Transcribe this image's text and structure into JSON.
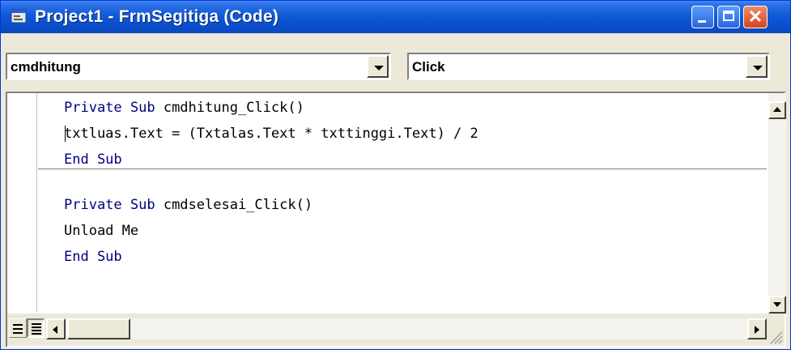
{
  "window": {
    "title": "Project1 - FrmSegitiga (Code)",
    "colors": {
      "titlebar": "#0a4fcc",
      "close_button": "#d6441f",
      "keyword": "#000080"
    }
  },
  "object_combo": {
    "value": "cmdhitung"
  },
  "procedure_combo": {
    "value": "Click"
  },
  "code": {
    "lines": [
      {
        "keyword": "Private Sub",
        "text": " cmdhitung_Click()"
      },
      {
        "keyword": "",
        "text": "txtluas.Text = (Txtalas.Text * txttinggi.Text) / 2"
      },
      {
        "keyword": "End Sub",
        "text": ""
      },
      {
        "keyword": "Private Sub",
        "text": " cmdselesai_Click()"
      },
      {
        "keyword": "",
        "text": "Unload Me"
      },
      {
        "keyword": "End Sub",
        "text": ""
      }
    ]
  },
  "icons": {
    "app": "vb-form-icon",
    "minimize": "minimize-icon",
    "maximize": "maximize-icon",
    "close": "close-icon",
    "close_glyph": "✕"
  }
}
